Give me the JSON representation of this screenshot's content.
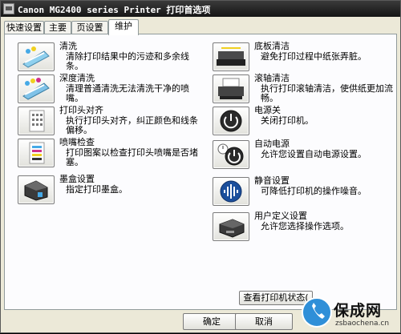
{
  "window": {
    "title": "Canon MG2400 series Printer 打印首选项"
  },
  "tabs": [
    {
      "label": "快速设置"
    },
    {
      "label": "主要"
    },
    {
      "label": "页设置"
    },
    {
      "label": "维护"
    }
  ],
  "left_items": [
    {
      "label": "清洗",
      "desc": "清除打印结果中的污迹和多余线条。",
      "icon": "cleaning-icon"
    },
    {
      "label": "深度清洗",
      "desc": "清理普通清洗无法清洗干净的喷嘴。",
      "icon": "deep-cleaning-icon"
    },
    {
      "label": "打印头对齐",
      "desc": "执行打印头对齐，纠正颜色和线条偏移。",
      "icon": "print-head-alignment-icon"
    },
    {
      "label": "喷嘴检查",
      "desc": "打印图案以检查打印头喷嘴是否堵塞。",
      "icon": "nozzle-check-icon"
    },
    {
      "label": "墨盒设置",
      "desc": "指定打印墨盒。",
      "icon": "ink-cartridge-icon"
    }
  ],
  "right_items": [
    {
      "label": "底板清洁",
      "desc": "避免打印过程中纸张弄脏。",
      "icon": "bottom-plate-cleaning-icon"
    },
    {
      "label": "滚轴清洁",
      "desc": "执行打印滚轴清洁，使供纸更加流畅。",
      "icon": "roller-cleaning-icon"
    },
    {
      "label": "电源关",
      "desc": "关闭打印机。",
      "icon": "power-off-icon"
    },
    {
      "label": "自动电源",
      "desc": "允许您设置自动电源设置。",
      "icon": "auto-power-icon"
    },
    {
      "label": "静音设置",
      "desc": "可降低打印机的操作噪音。",
      "icon": "quiet-settings-icon"
    },
    {
      "label": "用户定义设置",
      "desc": "允许您选择操作选项。",
      "icon": "custom-settings-icon"
    }
  ],
  "buttons": {
    "view_status": "查看打印机状态(",
    "ok": "确定",
    "cancel": "取消"
  },
  "watermark": {
    "brand": "保成网",
    "url": "zsbaochena.cn"
  },
  "colors": {
    "titlebar": "#1c1c1c",
    "tab_face": "#ece9d8",
    "panel": "#fcfcfe",
    "badge": "#2f8fd8"
  }
}
